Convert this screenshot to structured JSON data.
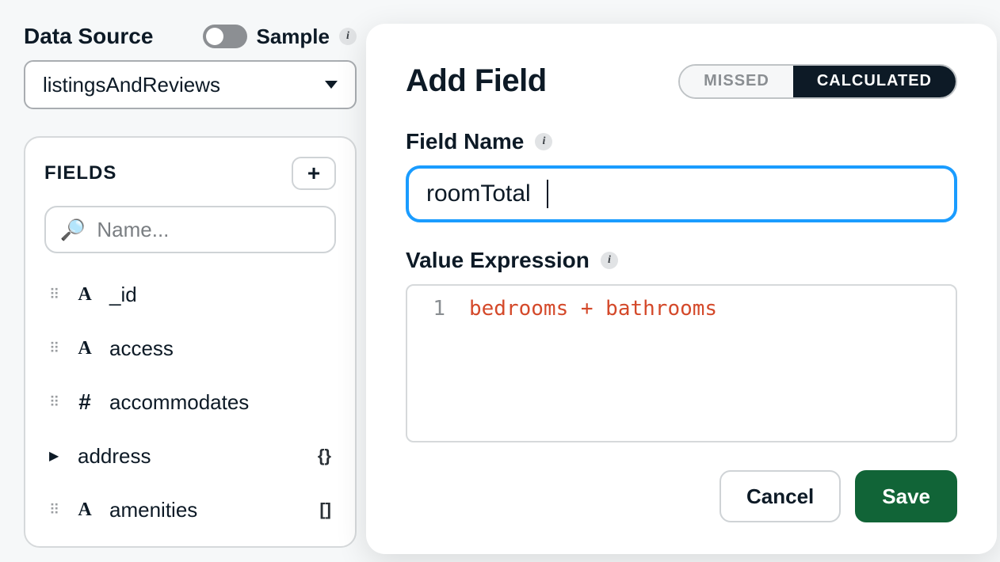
{
  "data_source": {
    "label": "Data Source",
    "toggle_label": "Sample",
    "selected": "listingsAndReviews"
  },
  "fields_panel": {
    "title": "FIELDS",
    "search_placeholder": "Name...",
    "items": [
      {
        "name": "_id",
        "type_glyph": "A",
        "drag": true,
        "expandable": false,
        "right_icon": ""
      },
      {
        "name": "access",
        "type_glyph": "A",
        "drag": true,
        "expandable": false,
        "right_icon": ""
      },
      {
        "name": "accommodates",
        "type_glyph": "#",
        "drag": true,
        "expandable": false,
        "right_icon": ""
      },
      {
        "name": "address",
        "type_glyph": "",
        "drag": false,
        "expandable": true,
        "right_icon": "{}"
      },
      {
        "name": "amenities",
        "type_glyph": "A",
        "drag": true,
        "expandable": false,
        "right_icon": "[]"
      }
    ]
  },
  "modal": {
    "title": "Add Field",
    "tabs": {
      "missed": "MISSED",
      "calculated": "CALCULATED"
    },
    "field_name_label": "Field Name",
    "field_name_value": "roomTotal",
    "value_expr_label": "Value Expression",
    "code_line_no": "1",
    "code_text": "bedrooms + bathrooms",
    "cancel_label": "Cancel",
    "save_label": "Save"
  }
}
